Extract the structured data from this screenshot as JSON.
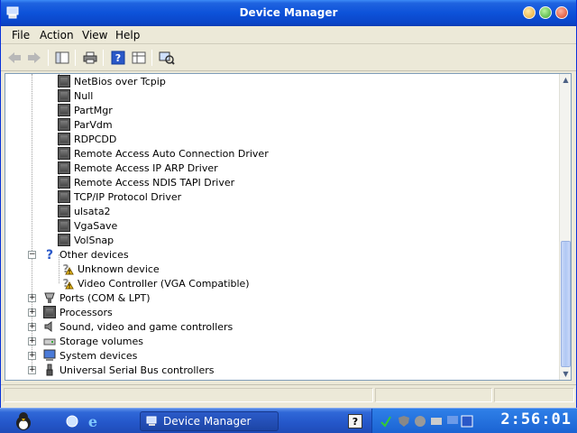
{
  "window": {
    "title": "Device Manager"
  },
  "menu": {
    "items": [
      "File",
      "Action",
      "View",
      "Help"
    ]
  },
  "toolbar": {
    "icons": [
      "back-arrow-icon",
      "forward-arrow-icon",
      "properties-view-icon",
      "print-icon",
      "help-icon",
      "details-view-icon",
      "scan-hardware-icon"
    ]
  },
  "tree": {
    "drivers": [
      "NetBios over Tcpip",
      "Null",
      "PartMgr",
      "ParVdm",
      "RDPCDD",
      "Remote Access Auto Connection Driver",
      "Remote Access IP ARP Driver",
      "Remote Access NDIS TAPI Driver",
      "TCP/IP Protocol Driver",
      "ulsata2",
      "VgaSave",
      "VolSnap"
    ],
    "other_devices": {
      "label": "Other devices",
      "children": [
        "Unknown device",
        "Video Controller (VGA Compatible)"
      ]
    },
    "categories": [
      "Ports (COM & LPT)",
      "Processors",
      "Sound, video and game controllers",
      "Storage volumes",
      "System devices",
      "Universal Serial Bus controllers"
    ]
  },
  "taskbar": {
    "task_label": "Device Manager",
    "clock": "2:56:01"
  },
  "colors": {
    "titlebar": "#0d52d9",
    "taskbar": "#2456c9",
    "accent": "#3a6ea5"
  }
}
